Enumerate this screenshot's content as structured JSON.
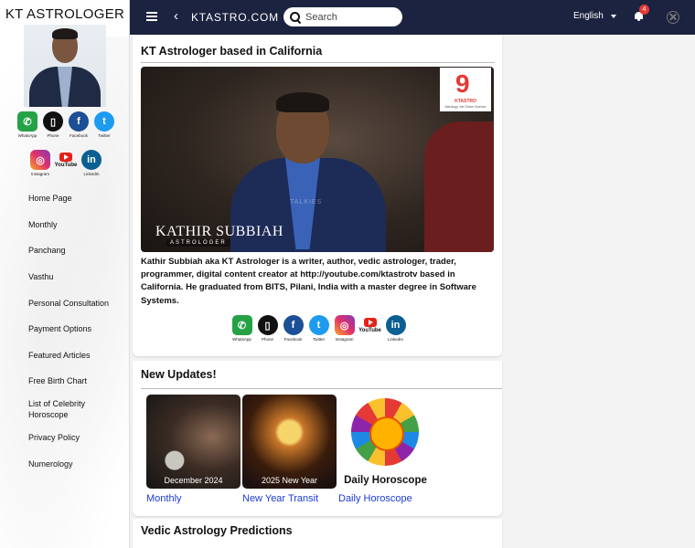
{
  "sidebar": {
    "site_title": "KT ASTROLOGER",
    "social_top": [
      {
        "label": "WhatsApp",
        "icon": "whatsapp-icon",
        "glyph": "✆"
      },
      {
        "label": "Phone",
        "icon": "phone-icon",
        "glyph": "▯"
      },
      {
        "label": "Facebook",
        "icon": "facebook-icon",
        "glyph": "f"
      },
      {
        "label": "Twitter",
        "icon": "twitter-icon",
        "glyph": "t"
      }
    ],
    "social_bottom": [
      {
        "label": "Instagram",
        "icon": "instagram-icon",
        "glyph": "◎"
      },
      {
        "label": "YouTube",
        "icon": "youtube-icon"
      },
      {
        "label": "LinkedIn",
        "icon": "linkedin-icon",
        "glyph": "in"
      }
    ],
    "nav": [
      "Home Page",
      "Monthly",
      "Panchang",
      "Vasthu",
      "Personal Consultation",
      "Payment Options",
      "Featured Articles",
      "Free Birth Chart",
      "List of Celebrity Horoscope",
      "Privacy Policy",
      "Numerology"
    ]
  },
  "header": {
    "brand": "KTASTRO.COM",
    "search_placeholder": "Search",
    "language": "English",
    "notification_count": "4"
  },
  "intro": {
    "title": "KT Astrologer based in California",
    "hero_name": "KATHIR SUBBIAH",
    "hero_role": "ASTROLOGER",
    "hero_watermark": "TALKIES",
    "logo_number": "9",
    "logo_brand": "KTASTRO",
    "logo_tag": "Astrology, the Divine Science",
    "bio": "Kathir Subbiah aka KT Astrologer is a writer, author, vedic astrologer, trader, programmer, digital content creator at http://youtube.com/ktastrotv based in California. He graduated from BITS, Pilani, India with a master degree in Software Systems.",
    "social": [
      {
        "label": "WhatsApp",
        "icon": "whatsapp-icon",
        "glyph": "✆"
      },
      {
        "label": "Phone",
        "icon": "phone-icon",
        "glyph": "▯"
      },
      {
        "label": "Facebook",
        "icon": "facebook-icon",
        "glyph": "f"
      },
      {
        "label": "Twitter",
        "icon": "twitter-icon",
        "glyph": "t"
      },
      {
        "label": "Instagram",
        "icon": "instagram-icon",
        "glyph": "◎"
      },
      {
        "label": "YouTube",
        "icon": "youtube-icon"
      },
      {
        "label": "LinkedIn",
        "icon": "linkedin-icon",
        "glyph": "in"
      }
    ]
  },
  "updates": {
    "title": "New Updates!",
    "items": [
      {
        "caption": "December 2024",
        "link": "Monthly"
      },
      {
        "caption": "2025 New Year",
        "link": "New Year Transit"
      },
      {
        "caption": "Daily Horoscope",
        "link": "Daily Horoscope"
      }
    ]
  },
  "vedic": {
    "title": "Vedic Astrology Predictions"
  }
}
